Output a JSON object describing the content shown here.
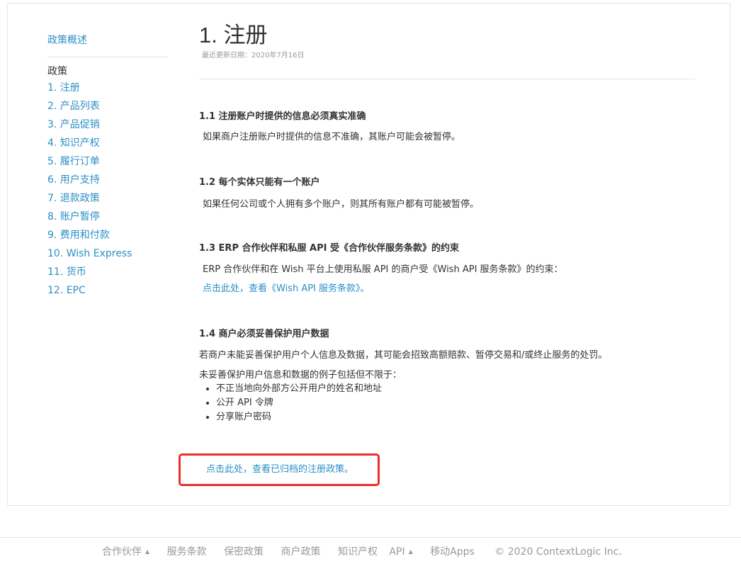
{
  "sidebar": {
    "overview": "政策概述",
    "heading": "政策",
    "items": [
      {
        "label": "1. 注册"
      },
      {
        "label": "2. 产品列表"
      },
      {
        "label": "3. 产品促销"
      },
      {
        "label": "4. 知识产权"
      },
      {
        "label": "5. 履行订单"
      },
      {
        "label": "6. 用户支持"
      },
      {
        "label": "7. 退款政策"
      },
      {
        "label": "8. 账户暂停"
      },
      {
        "label": "9. 费用和付款"
      },
      {
        "label": "10. Wish Express"
      },
      {
        "label": "11. 货币"
      },
      {
        "label": "12. EPC"
      }
    ]
  },
  "main": {
    "title": "1. 注册",
    "updated": "最近更新日期：2020年7月16日",
    "sections": [
      {
        "title": "1.1 注册账户时提供的信息必须真实准确",
        "text": "如果商户注册账户时提供的信息不准确，其账户可能会被暂停。"
      },
      {
        "title": "1.2 每个实体只能有一个账户",
        "text": "如果任何公司或个人拥有多个账户，则其所有账户都有可能被暂停。"
      },
      {
        "title": "1.3 ERP 合作伙伴和私服 API 受《合作伙伴服务条款》的约束",
        "text": "ERP 合作伙伴和在 Wish 平台上使用私服 API 的商户受《Wish API 服务条款》的约束：",
        "link": "点击此处，查看《Wish API 服务条款》。"
      },
      {
        "title": "1.4 商户必须妥善保护用户数据",
        "text": "若商户未能妥善保护用户个人信息及数据，其可能会招致高额赔款、暂停交易和/或终止服务的处罚。",
        "text2": "未妥善保护用户信息和数据的例子包括但不限于：",
        "bullets": [
          "不正当地向外部方公开用户的姓名和地址",
          "公开 API 令牌",
          "分享账户密码"
        ]
      }
    ],
    "archive_link": "点击此处，查看已归档的注册政策。"
  },
  "footer": {
    "partners": "合作伙伴",
    "terms": "服务条款",
    "privacy": "保密政策",
    "merchant_policy": "商户政策",
    "ip": "知识产权",
    "api": "API",
    "mobile": "移动Apps",
    "copyright": "© 2020 ContextLogic Inc."
  },
  "colors": {
    "link": "#2b8fc7",
    "highlight_border": "#e8302a",
    "muted": "#999999"
  }
}
